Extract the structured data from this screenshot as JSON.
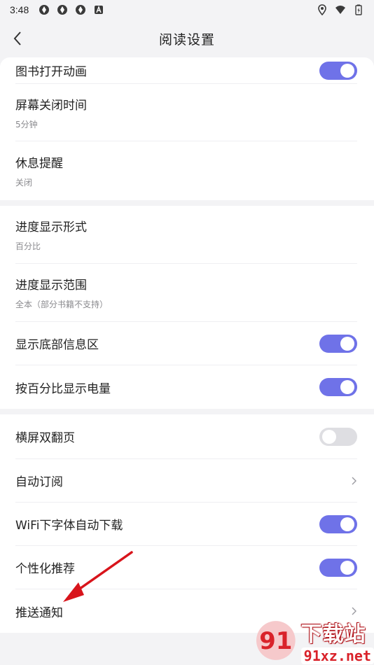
{
  "statusbar": {
    "time": "3:48",
    "icons": [
      "app-status-icon",
      "app-status-icon",
      "app-status-icon",
      "a-status-icon"
    ],
    "right_icons": [
      "location-icon",
      "wifi-icon",
      "battery-icon"
    ]
  },
  "navbar": {
    "title": "阅读设置"
  },
  "section1": {
    "items": [
      {
        "label": "图书打开动画",
        "toggle": "on"
      },
      {
        "label": "屏幕关闭时间",
        "sub": "5分钟"
      },
      {
        "label": "休息提醒",
        "sub": "关闭"
      }
    ]
  },
  "section2": {
    "items": [
      {
        "label": "进度显示形式",
        "sub": "百分比"
      },
      {
        "label": "进度显示范围",
        "sub": "全本（部分书籍不支持）"
      },
      {
        "label": "显示底部信息区",
        "toggle": "on"
      },
      {
        "label": "按百分比显示电量",
        "toggle": "on"
      }
    ]
  },
  "section3": {
    "items": [
      {
        "label": "横屏双翻页",
        "toggle": "off"
      },
      {
        "label": "自动订阅"
      },
      {
        "label": "WiFi下字体自动下载",
        "toggle": "on"
      },
      {
        "label": "个性化推荐",
        "toggle": "on"
      },
      {
        "label": "推送通知"
      }
    ]
  },
  "colors": {
    "accent": "#6f72e8",
    "toggle_off": "#dedee2",
    "background": "#f3f3f5",
    "annotation_arrow": "#d8141b"
  },
  "watermark": {
    "line1": "下载站",
    "line2": "91xz.net",
    "logo_text": "91"
  }
}
